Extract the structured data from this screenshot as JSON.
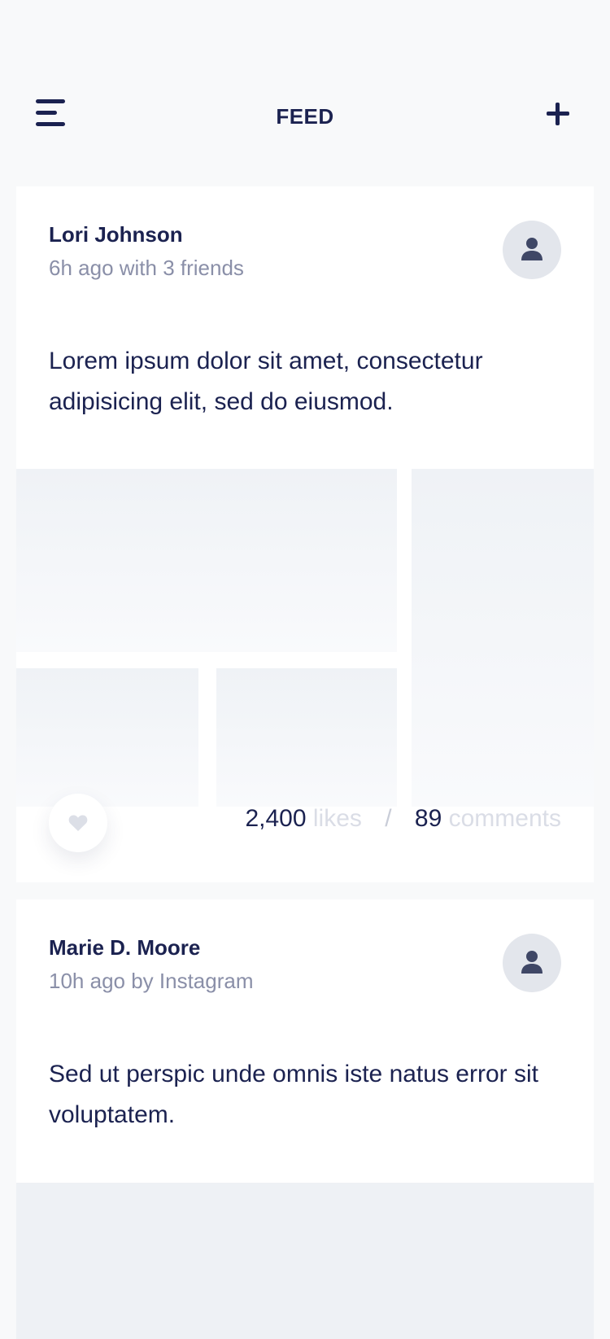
{
  "header": {
    "title": "FEED",
    "menu_icon": "menu-icon",
    "add_icon": "plus-icon"
  },
  "posts": [
    {
      "author": "Lori Johnson",
      "meta": "6h ago with 3 friends",
      "text": "Lorem ipsum dolor sit amet, consectetur adipisicing elit, sed do eiusmod.",
      "likes_count": "2,400",
      "likes_label": "likes",
      "separator": "/",
      "comments_count": "89",
      "comments_label": "comments"
    },
    {
      "author": "Marie D. Moore",
      "meta": "10h ago by Instagram",
      "text": "Sed ut perspic unde omnis iste natus error sit voluptatem."
    }
  ],
  "colors": {
    "background": "#F8F9FA",
    "card": "#FFFFFF",
    "primary_text": "#1B2250",
    "secondary_text": "#8A8FA8",
    "muted_label": "#DADDE6",
    "placeholder": "#EFF2F6",
    "avatar_bg": "#E3E6EC"
  }
}
